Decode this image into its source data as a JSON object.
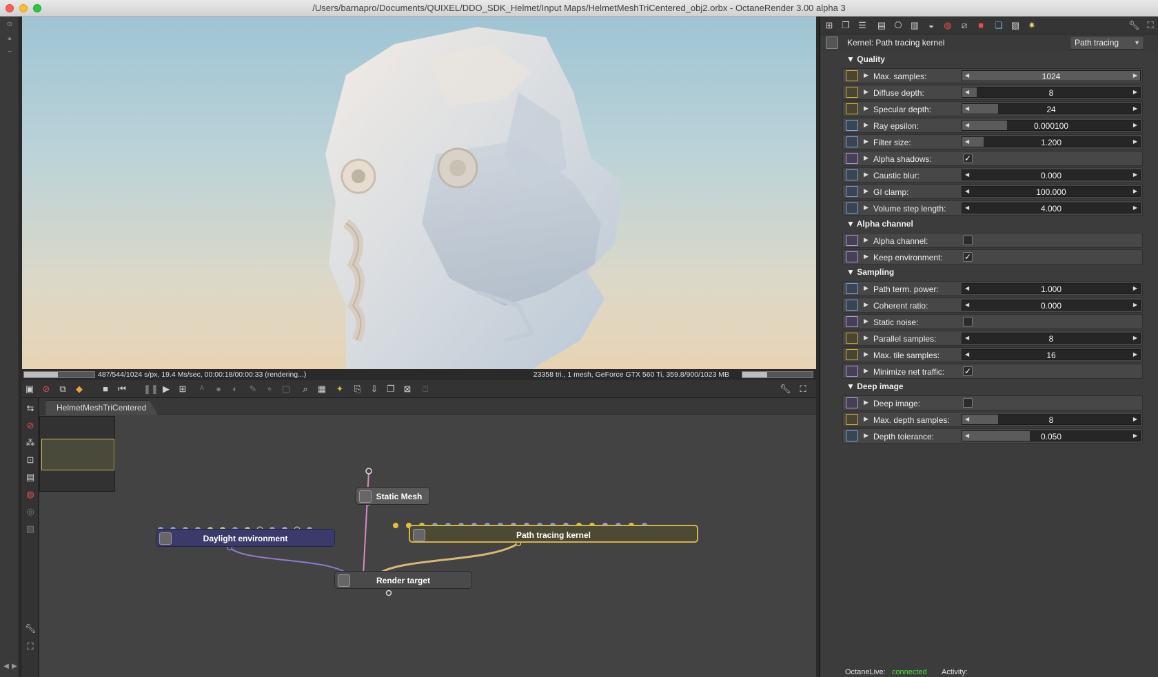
{
  "window": {
    "title": "/Users/barnapro/Documents/QUIXEL/DDO_SDK_Helmet/Input Maps/HelmetMeshTriCentered_obj2.orbx - OctaneRender 3.00 alpha 3"
  },
  "status": {
    "left": "487/544/1024 s/px, 19.4 Ms/sec, 00:00:18/00:00:33 (rendering...)",
    "right": "23358 tri., 1 mesh, GeForce GTX 560 Ti, 359.8/900/1023 MB",
    "progress_fraction": 0.476
  },
  "node_editor": {
    "tab_label": "HelmetMeshTriCentered",
    "nodes": {
      "static_mesh": "Static Mesh",
      "daylight": "Daylight environment",
      "path_tracing": "Path tracing kernel",
      "render_target": "Render target"
    }
  },
  "kernel": {
    "label": "Kernel: Path tracing kernel",
    "selected": "Path tracing"
  },
  "sections": {
    "quality": "Quality",
    "alpha": "Alpha channel",
    "sampling": "Sampling",
    "deep": "Deep image"
  },
  "params": {
    "max_samples": {
      "label": "Max. samples:",
      "value": "1024"
    },
    "diffuse_depth": {
      "label": "Diffuse depth:",
      "value": "8"
    },
    "specular_depth": {
      "label": "Specular depth:",
      "value": "24"
    },
    "ray_epsilon": {
      "label": "Ray epsilon:",
      "value": "0.000100"
    },
    "filter_size": {
      "label": "Filter size:",
      "value": "1.200"
    },
    "alpha_shadows": {
      "label": "Alpha shadows:",
      "checked": true
    },
    "caustic_blur": {
      "label": "Caustic blur:",
      "value": "0.000"
    },
    "gi_clamp": {
      "label": "GI clamp:",
      "value": "100.000"
    },
    "volume_step": {
      "label": "Volume step length:",
      "value": "4.000"
    },
    "alpha_channel": {
      "label": "Alpha channel:",
      "checked": false
    },
    "keep_env": {
      "label": "Keep environment:",
      "checked": true
    },
    "path_term": {
      "label": "Path term. power:",
      "value": "1.000"
    },
    "coherent": {
      "label": "Coherent ratio:",
      "value": "0.000"
    },
    "static_noise": {
      "label": "Static noise:",
      "checked": false
    },
    "parallel": {
      "label": "Parallel samples:",
      "value": "8"
    },
    "max_tile": {
      "label": "Max. tile samples:",
      "value": "16"
    },
    "min_net": {
      "label": "Minimize net traffic:",
      "checked": true
    },
    "deep_image": {
      "label": "Deep image:",
      "checked": false
    },
    "max_depth": {
      "label": "Max. depth samples:",
      "value": "8"
    },
    "depth_tol": {
      "label": "Depth tolerance:",
      "value": "0.050"
    }
  },
  "footer": {
    "octanelive_label": "OctaneLive:",
    "octanelive_status": "connected",
    "activity_label": "Activity:"
  },
  "colors": {
    "accent_yellow": "#d3b34c",
    "connected_green": "#4ede46"
  }
}
